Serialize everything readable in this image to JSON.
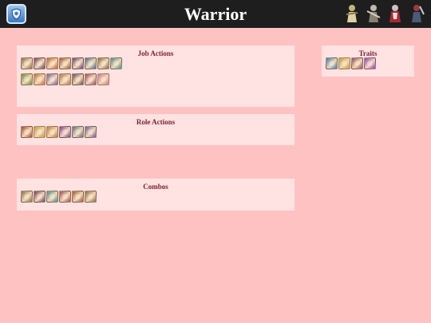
{
  "header": {
    "title": "Warrior",
    "job_icon": "shield-icon",
    "party_chars": [
      {
        "icon": "character-portrait-icon",
        "color": "#c9b27a"
      },
      {
        "icon": "character-portrait-icon",
        "color": "#bfb8ae"
      },
      {
        "icon": "character-portrait-icon",
        "color": "#a52a35"
      },
      {
        "icon": "character-portrait-icon",
        "color": "#4a5a78"
      }
    ]
  },
  "sections": {
    "job_actions": {
      "title": "Job Actions",
      "icons": [
        {
          "name": "skill-icon-1",
          "color": "#8a6b4c"
        },
        {
          "name": "skill-icon-2",
          "color": "#6b3d5c"
        },
        {
          "name": "skill-icon-3",
          "color": "#c0653a"
        },
        {
          "name": "skill-icon-4",
          "color": "#9a5a3a"
        },
        {
          "name": "skill-icon-5",
          "color": "#5f3f7a"
        },
        {
          "name": "skill-icon-6",
          "color": "#4c6a8c"
        },
        {
          "name": "skill-icon-7",
          "color": "#8a6b4c"
        },
        {
          "name": "skill-icon-8",
          "color": "#4c8a8c"
        },
        {
          "name": "skill-icon-9",
          "color": "#6a8a3c"
        },
        {
          "name": "skill-icon-10",
          "color": "#c4703a"
        },
        {
          "name": "skill-icon-11",
          "color": "#7a5aa0"
        },
        {
          "name": "skill-icon-12",
          "color": "#b07a4c"
        },
        {
          "name": "skill-icon-13",
          "color": "#6a4c5c"
        },
        {
          "name": "skill-icon-14",
          "color": "#a04c5c"
        },
        {
          "name": "skill-icon-15",
          "color": "#d07a8a"
        }
      ]
    },
    "role_actions": {
      "title": "Role Actions",
      "icons": [
        {
          "name": "role-skill-icon-1",
          "color": "#a0463a"
        },
        {
          "name": "role-skill-icon-2",
          "color": "#c49a3a"
        },
        {
          "name": "role-skill-icon-3",
          "color": "#c07a3a"
        },
        {
          "name": "role-skill-icon-4",
          "color": "#7a3aa0"
        },
        {
          "name": "role-skill-icon-5",
          "color": "#5a6a8a"
        },
        {
          "name": "role-skill-icon-6",
          "color": "#6a5aa0"
        }
      ]
    },
    "combos": {
      "title": "Combos",
      "icons": [
        {
          "name": "combo-skill-icon-1",
          "color": "#8a6b4c"
        },
        {
          "name": "combo-skill-icon-2",
          "color": "#6b3d5c"
        },
        {
          "name": "combo-skill-icon-3",
          "color": "#4c8a8c"
        },
        {
          "name": "combo-skill-icon-4",
          "color": "#a04c5c"
        },
        {
          "name": "combo-skill-icon-5",
          "color": "#9a5a3a"
        },
        {
          "name": "combo-skill-icon-6",
          "color": "#8a6b4c"
        }
      ]
    },
    "traits": {
      "title": "Traits",
      "icons": [
        {
          "name": "trait-icon-1",
          "color": "#3a7ab0"
        },
        {
          "name": "trait-icon-2",
          "color": "#c49a3a"
        },
        {
          "name": "trait-icon-3",
          "color": "#8a4c5c"
        },
        {
          "name": "trait-icon-4",
          "color": "#8a3ac0"
        }
      ]
    }
  }
}
